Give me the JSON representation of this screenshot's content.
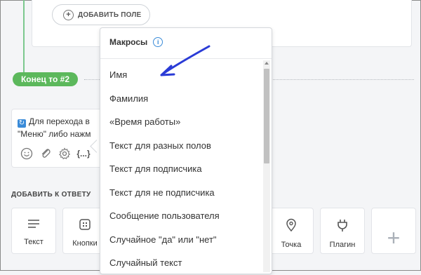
{
  "top": {
    "add_field_label": "ДОБАВИТЬ ПОЛЕ"
  },
  "flow": {
    "end_badge": "Конец то #2"
  },
  "message": {
    "line1": "Для перехода в",
    "line2": "\"Меню\" либо нажм",
    "tool_icons": [
      "emoji-icon",
      "attachment-icon",
      "gear-icon",
      "variables-icon"
    ],
    "variables_label": "{...}"
  },
  "add_to_answer": {
    "title": "ДОБАВИТЬ К ОТВЕТУ",
    "tiles": [
      {
        "label": "Текст",
        "icon": "text-lines-icon"
      },
      {
        "label": "Кнопки",
        "icon": "buttons-icon"
      },
      {
        "label": "Точка",
        "icon": "location-pin-icon"
      },
      {
        "label": "Плагин",
        "icon": "plug-icon"
      },
      {
        "label": "",
        "icon": "plus-icon"
      }
    ]
  },
  "macros": {
    "title": "Макросы",
    "items": [
      "Имя",
      "Фамилия",
      "«Время работы»",
      "Текст для разных полов",
      "Текст для подписчика",
      "Текст для не подписчика",
      "Сообщение пользователя",
      "Случайное \"да\" или \"нет\"",
      "Случайный текст"
    ]
  },
  "annotation": {
    "arrow_color": "#2a3bd6"
  },
  "colors": {
    "badge_green": "#5cb85c",
    "accent_blue": "#3a8bd8"
  }
}
